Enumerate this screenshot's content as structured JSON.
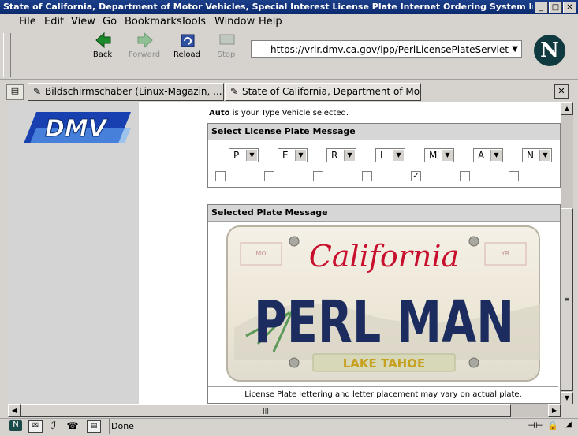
{
  "window": {
    "title": "State of California, Department of Motor Vehicles, Special Interest License Plate Internet Ordering System Internet Ordering Syste"
  },
  "menu": [
    "File",
    "Edit",
    "View",
    "Go",
    "Bookmarks",
    "Tools",
    "Window",
    "Help"
  ],
  "toolbar": {
    "back": "Back",
    "forward": "Forward",
    "reload": "Reload",
    "stop": "Stop"
  },
  "url": "https://vrir.dmv.ca.gov/ipp/PerlLicensePlateServlet",
  "tabs": [
    "Bildschirmschaber (Linux-Magazin, ...",
    "State of California, Department of Mot..."
  ],
  "page": {
    "logo_text": "DMV",
    "vehicle_bold": "Auto",
    "vehicle_rest": " is your Type Vehicle selected.",
    "select_header": "Select License Plate Message",
    "letters": [
      "P",
      "E",
      "R",
      "L",
      "M",
      "A",
      "N"
    ],
    "checked": [
      false,
      false,
      false,
      false,
      true,
      false,
      false
    ],
    "checkmark": "✓",
    "plate_header": "Selected Plate Message",
    "plate_state": "California",
    "plate_text": "PERL MAN",
    "plate_region": "LAKE TAHOE",
    "plate_tag_left": "MO",
    "plate_tag_right": "YR",
    "disclaimer": "License Plate lettering and letter placement may vary on actual plate."
  },
  "status": {
    "text": "Done"
  },
  "colors": {
    "title_bar": "#0b2a6f",
    "plate_red": "#c8102e",
    "plate_blue": "#1c2c5e",
    "dmv_blue": "#1840b0"
  }
}
